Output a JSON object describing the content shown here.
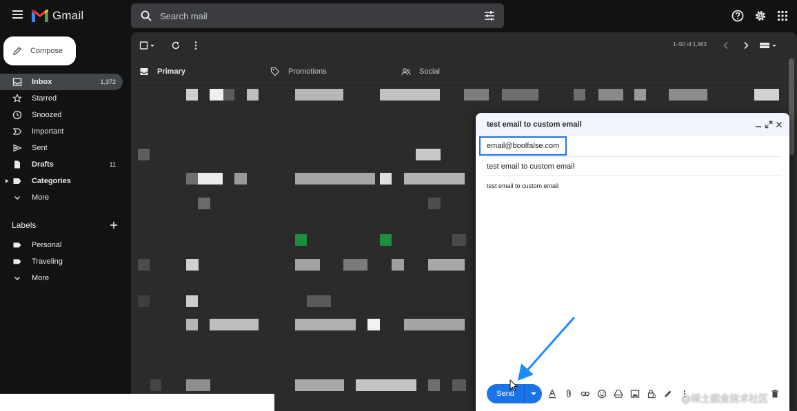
{
  "app": {
    "name": "Gmail"
  },
  "search": {
    "placeholder": "Search mail"
  },
  "compose_label": "Compose",
  "sidebar": {
    "items": [
      {
        "label": "Inbox",
        "count": "1,372"
      },
      {
        "label": "Starred",
        "count": ""
      },
      {
        "label": "Snoozed",
        "count": ""
      },
      {
        "label": "Important",
        "count": ""
      },
      {
        "label": "Sent",
        "count": ""
      },
      {
        "label": "Drafts",
        "count": "11"
      },
      {
        "label": "Categories",
        "count": ""
      },
      {
        "label": "More",
        "count": ""
      }
    ],
    "labels_heading": "Labels",
    "labels": [
      {
        "label": "Personal"
      },
      {
        "label": "Traveling"
      },
      {
        "label": "More"
      }
    ]
  },
  "toolbar": {
    "pagination": "1–50 of 1,963"
  },
  "tabs": [
    {
      "label": "Primary"
    },
    {
      "label": "Promotions"
    },
    {
      "label": "Social"
    }
  ],
  "compose_window": {
    "title": "test email to custom email",
    "to": "email@boolfalse.com",
    "subject": "test email to custom email",
    "body": "test email to custom email",
    "send_label": "Send"
  },
  "watermark": "@稀土掘金技术社区",
  "colors": {
    "accent": "#1a73e8",
    "annotation": "#1a8cff",
    "label_green": "#1e8e3e"
  }
}
